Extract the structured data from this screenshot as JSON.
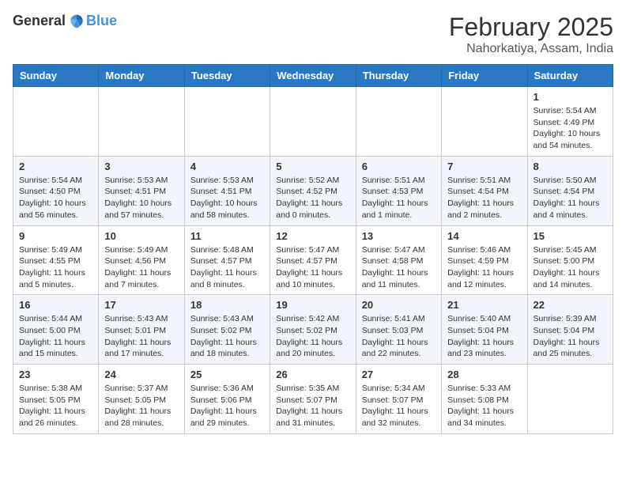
{
  "header": {
    "logo_general": "General",
    "logo_blue": "Blue",
    "month": "February 2025",
    "location": "Nahorkatiya, Assam, India"
  },
  "days_of_week": [
    "Sunday",
    "Monday",
    "Tuesday",
    "Wednesday",
    "Thursday",
    "Friday",
    "Saturday"
  ],
  "weeks": [
    [
      {
        "day": "",
        "info": ""
      },
      {
        "day": "",
        "info": ""
      },
      {
        "day": "",
        "info": ""
      },
      {
        "day": "",
        "info": ""
      },
      {
        "day": "",
        "info": ""
      },
      {
        "day": "",
        "info": ""
      },
      {
        "day": "1",
        "info": "Sunrise: 5:54 AM\nSunset: 4:49 PM\nDaylight: 10 hours\nand 54 minutes."
      }
    ],
    [
      {
        "day": "2",
        "info": "Sunrise: 5:54 AM\nSunset: 4:50 PM\nDaylight: 10 hours\nand 56 minutes."
      },
      {
        "day": "3",
        "info": "Sunrise: 5:53 AM\nSunset: 4:51 PM\nDaylight: 10 hours\nand 57 minutes."
      },
      {
        "day": "4",
        "info": "Sunrise: 5:53 AM\nSunset: 4:51 PM\nDaylight: 10 hours\nand 58 minutes."
      },
      {
        "day": "5",
        "info": "Sunrise: 5:52 AM\nSunset: 4:52 PM\nDaylight: 11 hours\nand 0 minutes."
      },
      {
        "day": "6",
        "info": "Sunrise: 5:51 AM\nSunset: 4:53 PM\nDaylight: 11 hours\nand 1 minute."
      },
      {
        "day": "7",
        "info": "Sunrise: 5:51 AM\nSunset: 4:54 PM\nDaylight: 11 hours\nand 2 minutes."
      },
      {
        "day": "8",
        "info": "Sunrise: 5:50 AM\nSunset: 4:54 PM\nDaylight: 11 hours\nand 4 minutes."
      }
    ],
    [
      {
        "day": "9",
        "info": "Sunrise: 5:49 AM\nSunset: 4:55 PM\nDaylight: 11 hours\nand 5 minutes."
      },
      {
        "day": "10",
        "info": "Sunrise: 5:49 AM\nSunset: 4:56 PM\nDaylight: 11 hours\nand 7 minutes."
      },
      {
        "day": "11",
        "info": "Sunrise: 5:48 AM\nSunset: 4:57 PM\nDaylight: 11 hours\nand 8 minutes."
      },
      {
        "day": "12",
        "info": "Sunrise: 5:47 AM\nSunset: 4:57 PM\nDaylight: 11 hours\nand 10 minutes."
      },
      {
        "day": "13",
        "info": "Sunrise: 5:47 AM\nSunset: 4:58 PM\nDaylight: 11 hours\nand 11 minutes."
      },
      {
        "day": "14",
        "info": "Sunrise: 5:46 AM\nSunset: 4:59 PM\nDaylight: 11 hours\nand 12 minutes."
      },
      {
        "day": "15",
        "info": "Sunrise: 5:45 AM\nSunset: 5:00 PM\nDaylight: 11 hours\nand 14 minutes."
      }
    ],
    [
      {
        "day": "16",
        "info": "Sunrise: 5:44 AM\nSunset: 5:00 PM\nDaylight: 11 hours\nand 15 minutes."
      },
      {
        "day": "17",
        "info": "Sunrise: 5:43 AM\nSunset: 5:01 PM\nDaylight: 11 hours\nand 17 minutes."
      },
      {
        "day": "18",
        "info": "Sunrise: 5:43 AM\nSunset: 5:02 PM\nDaylight: 11 hours\nand 18 minutes."
      },
      {
        "day": "19",
        "info": "Sunrise: 5:42 AM\nSunset: 5:02 PM\nDaylight: 11 hours\nand 20 minutes."
      },
      {
        "day": "20",
        "info": "Sunrise: 5:41 AM\nSunset: 5:03 PM\nDaylight: 11 hours\nand 22 minutes."
      },
      {
        "day": "21",
        "info": "Sunrise: 5:40 AM\nSunset: 5:04 PM\nDaylight: 11 hours\nand 23 minutes."
      },
      {
        "day": "22",
        "info": "Sunrise: 5:39 AM\nSunset: 5:04 PM\nDaylight: 11 hours\nand 25 minutes."
      }
    ],
    [
      {
        "day": "23",
        "info": "Sunrise: 5:38 AM\nSunset: 5:05 PM\nDaylight: 11 hours\nand 26 minutes."
      },
      {
        "day": "24",
        "info": "Sunrise: 5:37 AM\nSunset: 5:05 PM\nDaylight: 11 hours\nand 28 minutes."
      },
      {
        "day": "25",
        "info": "Sunrise: 5:36 AM\nSunset: 5:06 PM\nDaylight: 11 hours\nand 29 minutes."
      },
      {
        "day": "26",
        "info": "Sunrise: 5:35 AM\nSunset: 5:07 PM\nDaylight: 11 hours\nand 31 minutes."
      },
      {
        "day": "27",
        "info": "Sunrise: 5:34 AM\nSunset: 5:07 PM\nDaylight: 11 hours\nand 32 minutes."
      },
      {
        "day": "28",
        "info": "Sunrise: 5:33 AM\nSunset: 5:08 PM\nDaylight: 11 hours\nand 34 minutes."
      },
      {
        "day": "",
        "info": ""
      }
    ]
  ]
}
